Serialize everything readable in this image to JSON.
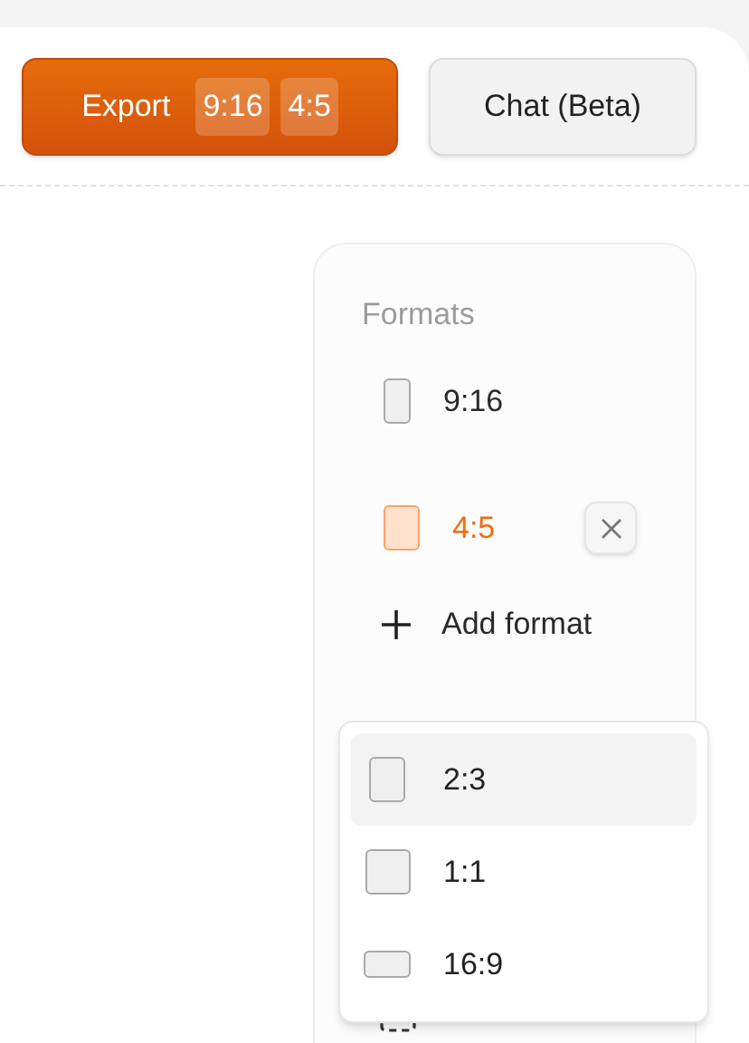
{
  "toolbar": {
    "export_button": {
      "label": "Export",
      "badges": [
        "9:16",
        "4:5"
      ]
    },
    "chat_button": {
      "label": "Chat (Beta)"
    }
  },
  "formats_panel": {
    "title": "Formats",
    "items": [
      {
        "label": "9:16",
        "kind": "tall",
        "selected": false
      },
      {
        "label": "4:5",
        "kind": "portrait",
        "selected": true
      }
    ],
    "add_label": "Add format"
  },
  "format_menu": [
    {
      "label": "2:3",
      "kind": "portrait",
      "selected": true
    },
    {
      "label": "1:1",
      "kind": "square",
      "selected": false
    },
    {
      "label": "16:9",
      "kind": "wide",
      "selected": false
    }
  ]
}
